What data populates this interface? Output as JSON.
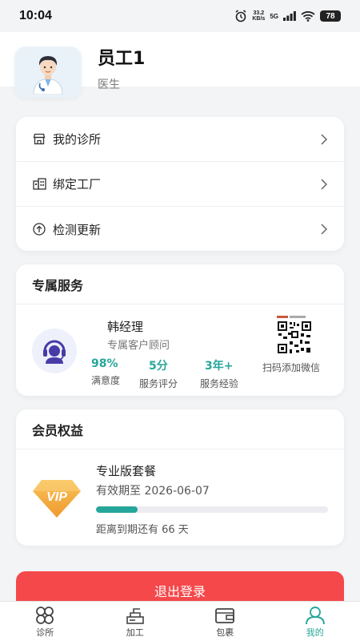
{
  "status_bar": {
    "time": "10:04",
    "net_speed_value": "33.2",
    "net_speed_unit": "KB/s",
    "network": "5G",
    "battery": "78"
  },
  "profile": {
    "name": "员工1",
    "role": "医生"
  },
  "menu": [
    {
      "label": "我的诊所",
      "icon": "store-icon"
    },
    {
      "label": "绑定工厂",
      "icon": "factory-icon"
    },
    {
      "label": "检测更新",
      "icon": "upload-circle-icon"
    }
  ],
  "service": {
    "title": "专属服务",
    "advisor_name": "韩经理",
    "advisor_title": "专属客户顾问",
    "stats": [
      {
        "value": "98%",
        "label": "满意度"
      },
      {
        "value": "5分",
        "label": "服务评分"
      },
      {
        "value": "3年+",
        "label": "服务经验"
      }
    ],
    "qr_label": "扫码添加微信"
  },
  "membership": {
    "title": "会员权益",
    "badge": "VIP",
    "plan_name": "专业版套餐",
    "valid_until": "有效期至 2026-06-07",
    "progress": 0.18,
    "remaining": "距离到期还有 66 天"
  },
  "logout_label": "退出登录",
  "tabs": [
    {
      "label": "诊所",
      "active": false
    },
    {
      "label": "加工",
      "active": false
    },
    {
      "label": "包裹",
      "active": false
    },
    {
      "label": "我的",
      "active": true
    }
  ],
  "colors": {
    "accent": "#27a69a",
    "danger": "#f5484a",
    "vip_gold": "#f2a53a"
  }
}
